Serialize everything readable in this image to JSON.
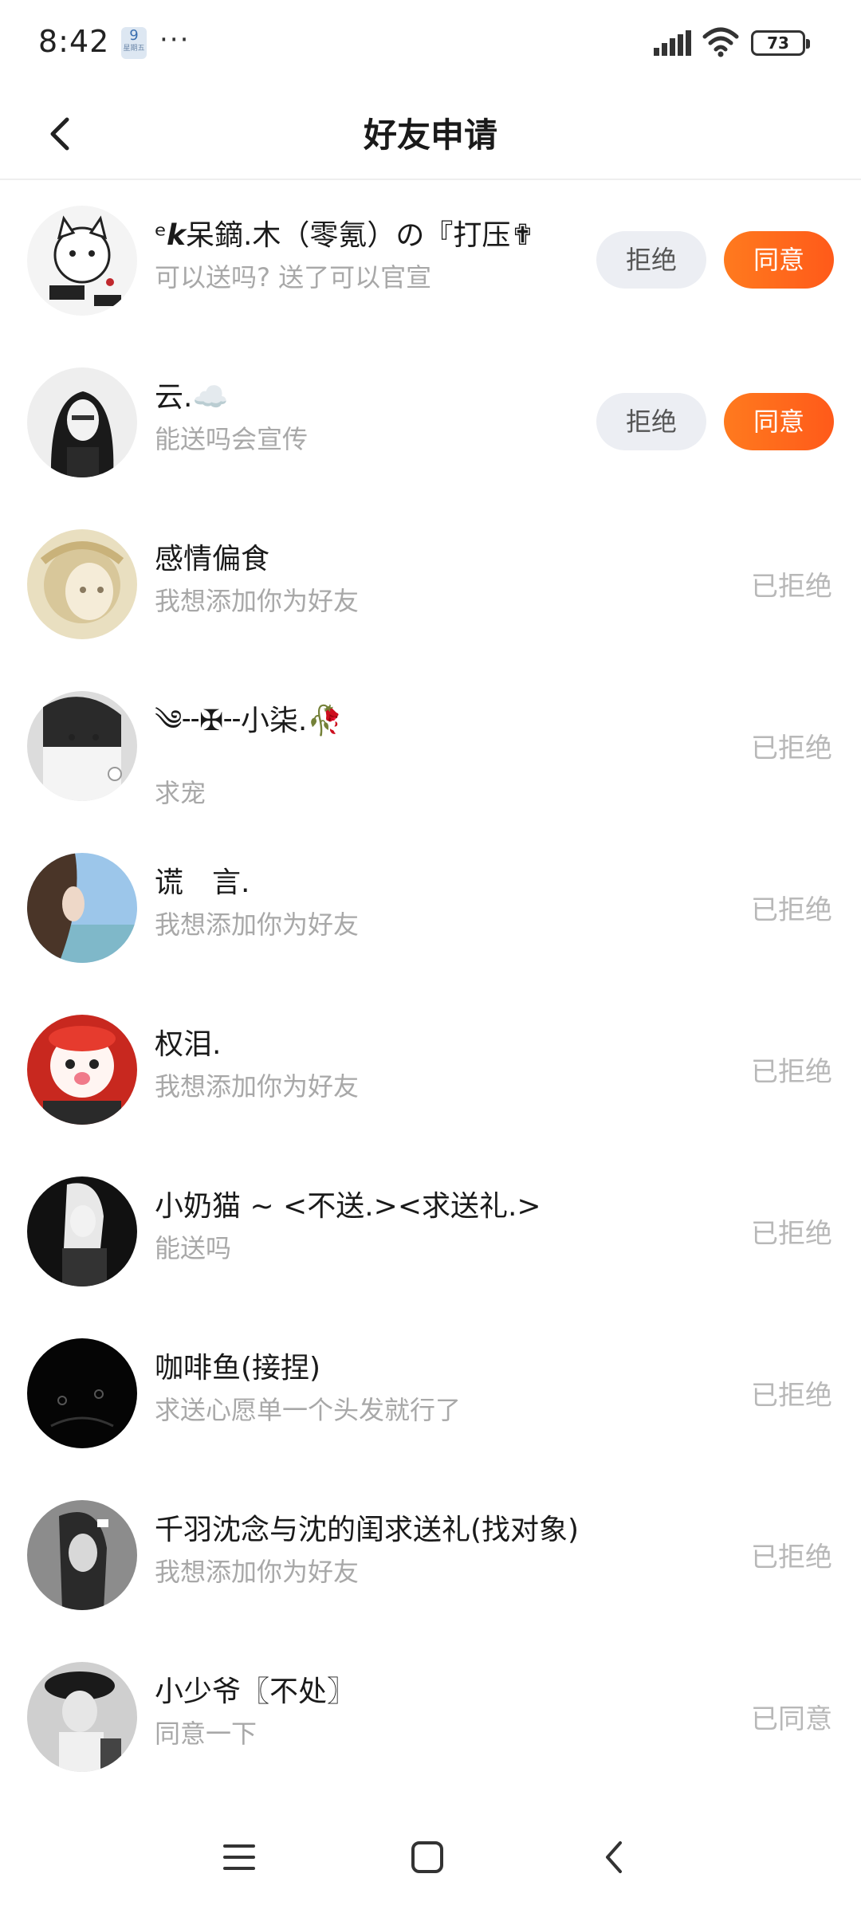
{
  "status_bar": {
    "time": "8:42",
    "badge_number": "9",
    "badge_sub": "星期五",
    "dots": "···",
    "battery": "73"
  },
  "header": {
    "title": "好友申请"
  },
  "requests": [
    {
      "name": "ᵉ𝙠呆鏑.木（零氪）の『打压✟",
      "message": "可以送吗? 送了可以官宣",
      "state": "pending"
    },
    {
      "name": "云.☁️",
      "message": "能送吗会宣传",
      "state": "pending"
    },
    {
      "name": "感情偏食",
      "message": "我想添加你为好友",
      "state": "rejected"
    },
    {
      "name": "༄╌✠╌小柒.🥀",
      "message": "求宠",
      "state": "rejected"
    },
    {
      "name": "谎　言.",
      "message": "我想添加你为好友",
      "state": "rejected"
    },
    {
      "name": "权泪.",
      "message": "我想添加你为好友",
      "state": "rejected"
    },
    {
      "name": "小奶猫 ~ <不送.><求送礼.>",
      "message": "能送吗",
      "state": "rejected"
    },
    {
      "name": "咖啡鱼(接捏)",
      "message": "求送心愿单一个头发就行了",
      "state": "rejected"
    },
    {
      "name": "千羽沈念与沈的闺求送礼(找对象)",
      "message": "我想添加你为好友",
      "state": "rejected"
    },
    {
      "name": "小少爷〖不处〗",
      "message": "同意一下",
      "state": "accepted"
    }
  ],
  "labels": {
    "reject": "拒绝",
    "accept": "同意",
    "rejected": "已拒绝",
    "accepted": "已同意"
  },
  "colors": {
    "accent": "#ff6a1e",
    "reject_bg": "#eceef3",
    "muted": "#a8a8a8"
  },
  "icons": {
    "back": "chevron-left-icon",
    "nav_menu": "menu-icon",
    "nav_home": "home-square-icon",
    "nav_back": "back-arrow-icon"
  }
}
